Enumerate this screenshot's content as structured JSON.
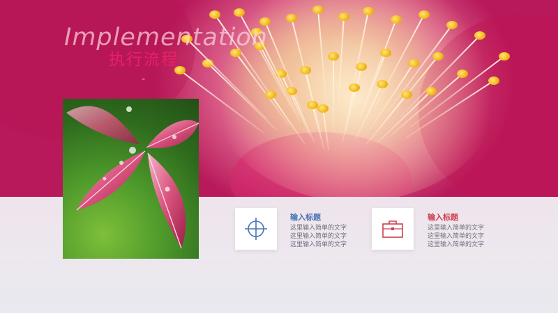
{
  "title": {
    "english": "Implementation",
    "chinese": "执行流程",
    "dash": "-"
  },
  "items": [
    {
      "heading": "输入标题",
      "lines": [
        "这里输入简单的文字",
        "这里输入简单的文字",
        "这里输入简单的文字"
      ],
      "icon": "crosshair-icon",
      "color": "#4873b4"
    },
    {
      "heading": "输入标题",
      "lines": [
        "这里输入简单的文字",
        "这里输入简单的文字",
        "这里输入简单的文字"
      ],
      "icon": "briefcase-icon",
      "color": "#cc4052"
    }
  ]
}
